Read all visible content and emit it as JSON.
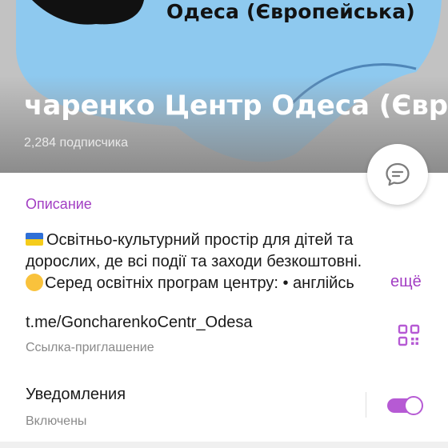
{
  "header": {
    "banner_text": "Одеса (Європейська)",
    "title": "чаренко Центр Одеса (Євр",
    "subscribers": "2,284 подписчика"
  },
  "description": {
    "section_title": "Описание",
    "line1": "Освітньо-культурний простір для дітей та",
    "line2": "дорослих, де всі події та заходи безкоштовні.",
    "line3": "Серед освітніх програм центру: • англійсь",
    "more_label": "ещё"
  },
  "invite": {
    "link": "t.me/GoncharenkoCentr_Odesa",
    "label": "Ссылка-приглашение"
  },
  "notifications": {
    "title": "Уведомления",
    "status": "Включены",
    "enabled": true
  },
  "icons": {
    "message_fab": "message-bubble-icon",
    "qr": "qr-code-icon",
    "flag": "ukraine-flag-icon",
    "emoji": "hugging-face-icon"
  },
  "colors": {
    "accent": "#a23ec3",
    "toggle": "#b65ad4",
    "avatar_blue": "#8ec9ef"
  }
}
